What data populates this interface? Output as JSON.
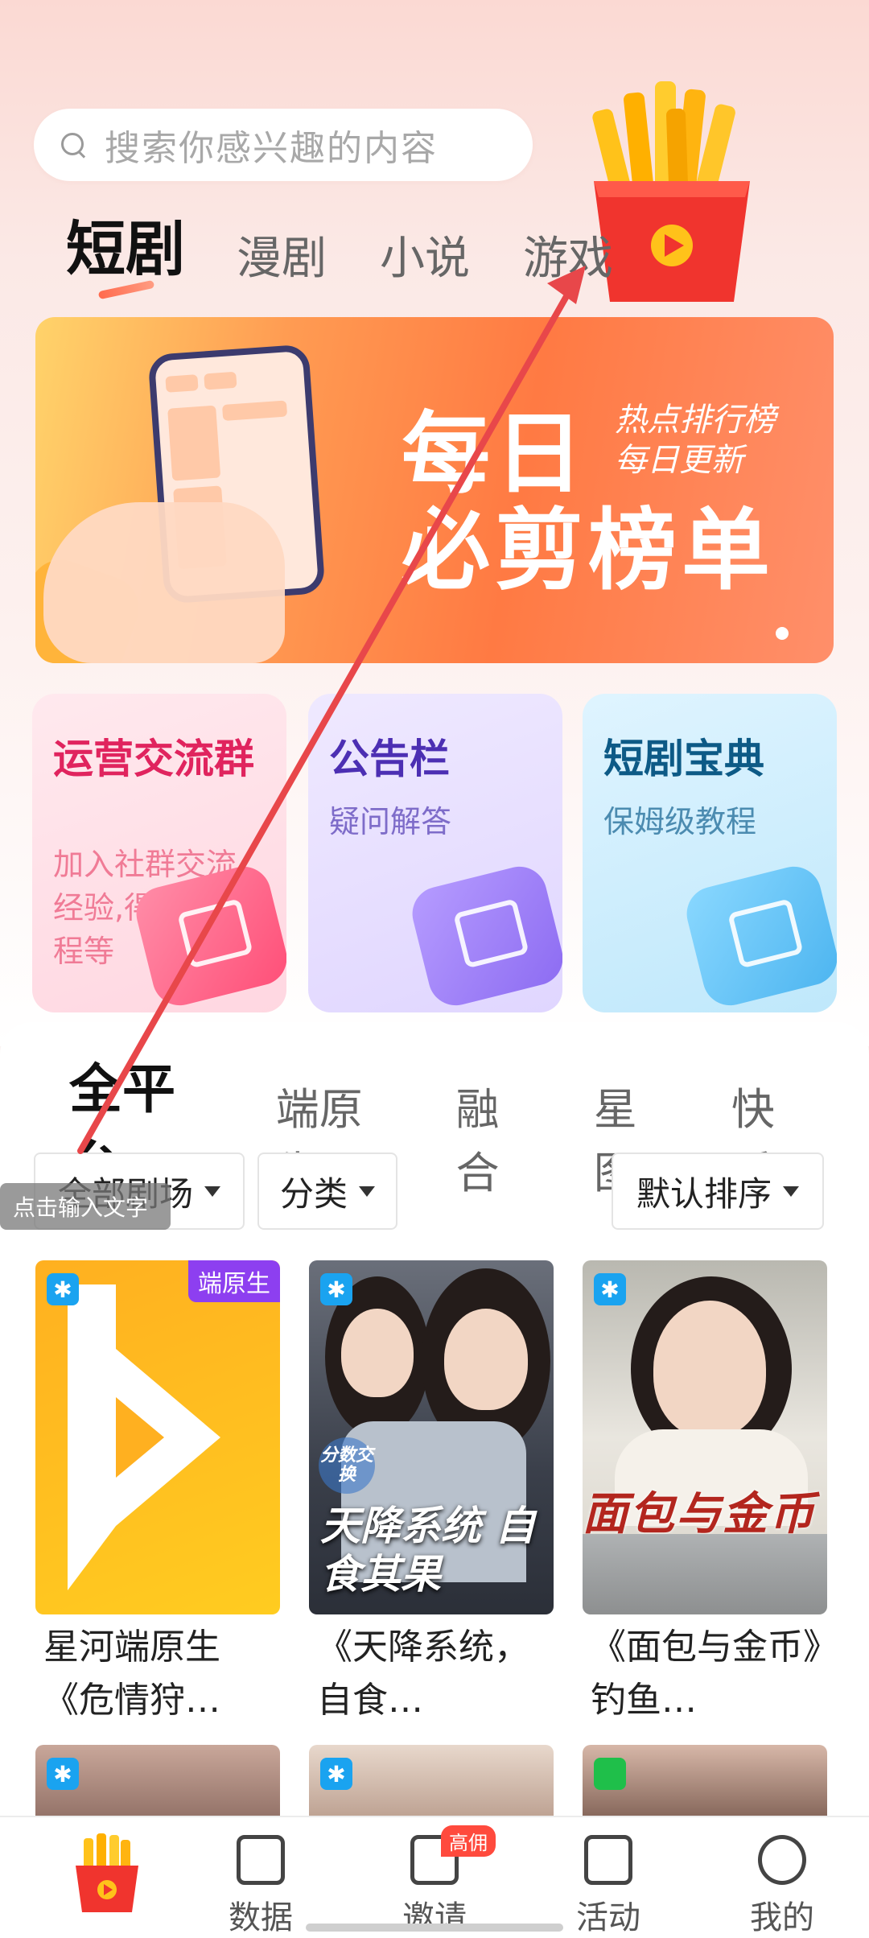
{
  "search": {
    "placeholder": "搜索你感兴趣的内容"
  },
  "category_tabs": [
    {
      "label": "短剧",
      "active": true
    },
    {
      "label": "漫剧",
      "active": false
    },
    {
      "label": "小说",
      "active": false
    },
    {
      "label": "游戏",
      "active": false
    }
  ],
  "banner": {
    "title_line1": "每日",
    "title_line2": "必剪榜单",
    "sub_line1": "热点排行榜",
    "sub_line2": "每日更新"
  },
  "tool_cards": [
    {
      "title": "运营交流群",
      "subtitle": "加入社群交流经验,得培训课程等"
    },
    {
      "title": "公告栏",
      "subtitle": "疑问解答"
    },
    {
      "title": "短剧宝典",
      "subtitle": "保姆级教程"
    }
  ],
  "platform_tabs": [
    {
      "label": "全平台",
      "active": true
    },
    {
      "label": "端原生",
      "active": false
    },
    {
      "label": "融合",
      "active": false
    },
    {
      "label": "星图",
      "active": false
    },
    {
      "label": "快手",
      "active": false
    }
  ],
  "filters": {
    "theater": "全部剧场",
    "category": "分类",
    "sort": "默认排序"
  },
  "tooltip": "点击输入文字",
  "dramas": [
    {
      "title": "星河端原生《危情狩…",
      "badge": "端原生",
      "poster_text": ""
    },
    {
      "title": "《天降系统，自食…",
      "badge": "",
      "poster_text": "天降系统 自食其果",
      "poster_tag": "分数交换"
    },
    {
      "title": "《面包与金币》钓鱼…",
      "badge": "",
      "poster_text": "面包与金币"
    }
  ],
  "bottom_nav": [
    {
      "label": "",
      "icon": "fries-home-icon"
    },
    {
      "label": "数据",
      "icon": "data-icon"
    },
    {
      "label": "邀请",
      "icon": "invite-icon",
      "badge": "高佣"
    },
    {
      "label": "活动",
      "icon": "activity-icon"
    },
    {
      "label": "我的",
      "icon": "profile-icon"
    }
  ],
  "colors": {
    "accent": "#ff5d47",
    "annotation_arrow": "#e8474a"
  }
}
